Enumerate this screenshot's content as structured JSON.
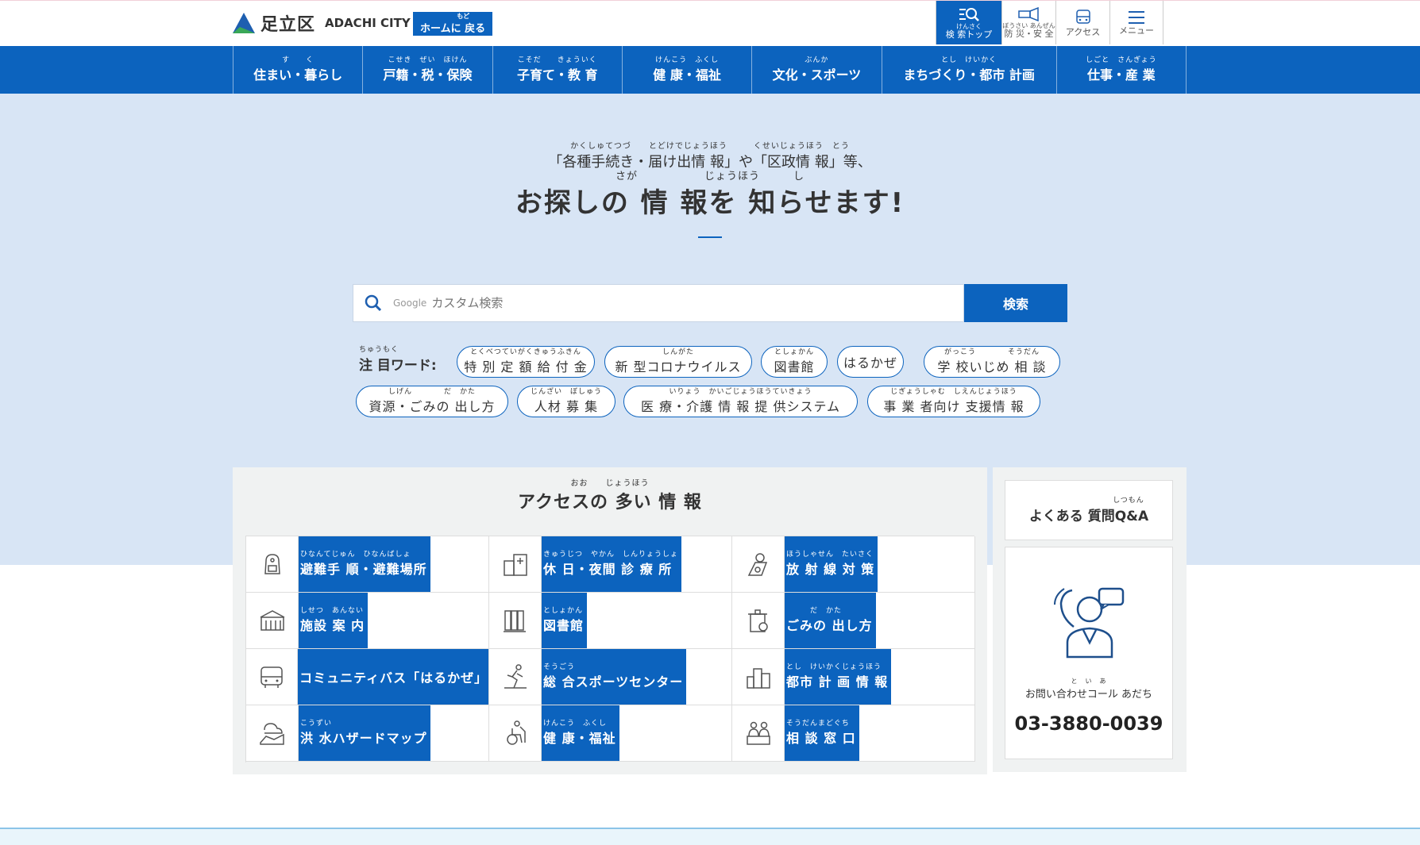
{
  "header": {
    "logo_ja": "足立区",
    "logo_en": "ADACHI CITY",
    "home_button": {
      "ruby": "もど",
      "label": "ホームに 戻る"
    },
    "buttons": [
      {
        "ruby": "けんさく",
        "label": "検 索トップ",
        "active": true,
        "icon": "search-icon"
      },
      {
        "ruby": "ぼうさい あんぜん",
        "label": "防 災・安 全",
        "active": false,
        "icon": "megaphone-icon"
      },
      {
        "ruby": "",
        "label": "アクセス",
        "active": false,
        "icon": "bus-icon"
      },
      {
        "ruby": "",
        "label": "メニュー",
        "active": false,
        "icon": "hamburger-icon"
      }
    ]
  },
  "nav": [
    {
      "ruby": "す　　く",
      "label": "住まい・暮らし"
    },
    {
      "ruby": "こせき　ぜい　ほけん",
      "label": "戸籍・税・保険"
    },
    {
      "ruby": "こそだ　　きょういく",
      "label": "子育て・教 育"
    },
    {
      "ruby": "けんこう　ふくし",
      "label": "健 康・福祉"
    },
    {
      "ruby": "ぶんか",
      "label": "文化・スポーツ"
    },
    {
      "ruby": "とし　けいかく",
      "label": "まちづくり・都市 計画"
    },
    {
      "ruby": "しごと　さんぎょう",
      "label": "仕事・産 業"
    }
  ],
  "hero": {
    "sub_ruby": "かくしゅてつづ　　とどけでじょうほう　　　くせいじょうほう　とう",
    "sub": "「各種手続き・届け出情 報」や「区政情 報」等、",
    "title_ruby": "さが　　　　　　じょうほう　　　し",
    "title": "お探しの 情 報を 知らせます!"
  },
  "search": {
    "brand": "Google",
    "placeholder": "カスタム検索",
    "button": "検索"
  },
  "keywords": {
    "label_ruby": "ちゅうもく",
    "label": "注 目ワード:",
    "items": [
      {
        "ruby": "とくべつていがくきゅうふきん",
        "label": "特 別 定 額 給 付 金"
      },
      {
        "ruby": "しんがた",
        "label": "新 型コロナウイルス"
      },
      {
        "ruby": "としょかん",
        "label": "図書館"
      },
      {
        "ruby": "",
        "label": "はるかぜ"
      },
      {
        "ruby": "がっこう　　　　そうだん",
        "label": "学 校いじめ 相 談"
      },
      {
        "ruby": "しげん　　　　だ　かた",
        "label": "資源・ごみの 出し方"
      },
      {
        "ruby": "じんざい　ぼしゅう",
        "label": "人材 募 集"
      },
      {
        "ruby": "いりょう　かいごじょうほうていきょう",
        "label": "医 療・介護 情 報 提 供システム"
      },
      {
        "ruby": "じぎょうしゃむ　しえんじょうほう",
        "label": "事 業 者向け 支援情 報"
      }
    ]
  },
  "access": {
    "title_ruby": "おお　　じょうほう",
    "title": "アクセスの 多い 情 報",
    "items": [
      {
        "ruby": "ひなんてじゅん　ひなんばしょ",
        "label": "避難手 順・避難場所",
        "icon": "backpack-icon"
      },
      {
        "ruby": "きゅうじつ　やかん　しんりょうしょ",
        "label": "休 日・夜間 診 療 所",
        "icon": "hospital-icon"
      },
      {
        "ruby": "ほうしゃせん　たいさく",
        "label": "放 射 線 対 策",
        "icon": "radiation-icon"
      },
      {
        "ruby": "しせつ　あんない",
        "label": "施設 案 内",
        "icon": "facility-icon"
      },
      {
        "ruby": "としょかん",
        "label": "図書館",
        "icon": "books-icon"
      },
      {
        "ruby": "　　　だ　かた",
        "label": "ごみの 出し方",
        "icon": "trash-icon"
      },
      {
        "ruby": "",
        "label": "コミュニティバス「はるかぜ」",
        "icon": "bus-icon"
      },
      {
        "ruby": "そうごう",
        "label": "総 合スポーツセンター",
        "icon": "runner-icon"
      },
      {
        "ruby": "とし　けいかくじょうほう",
        "label": "都市 計 画 情 報",
        "icon": "city-icon"
      },
      {
        "ruby": "こうずい",
        "label": "洪 水ハザードマップ",
        "icon": "flood-map-icon"
      },
      {
        "ruby": "けんこう　ふくし",
        "label": "健 康・福祉",
        "icon": "wheelchair-icon"
      },
      {
        "ruby": "そうだんまどぐち",
        "label": "相 談 窓 口",
        "icon": "consult-icon"
      }
    ]
  },
  "faq": {
    "ruby": "しつもん",
    "label": "よくある 質問Q&A"
  },
  "call": {
    "ruby": "と　い　あ",
    "label": "お問い合わせコール あだち",
    "number": "03-3880-0039"
  },
  "colors": {
    "primary": "#0c63be",
    "hero_bg": "#d8e5f5",
    "panel_bg": "#f0f2f2"
  }
}
